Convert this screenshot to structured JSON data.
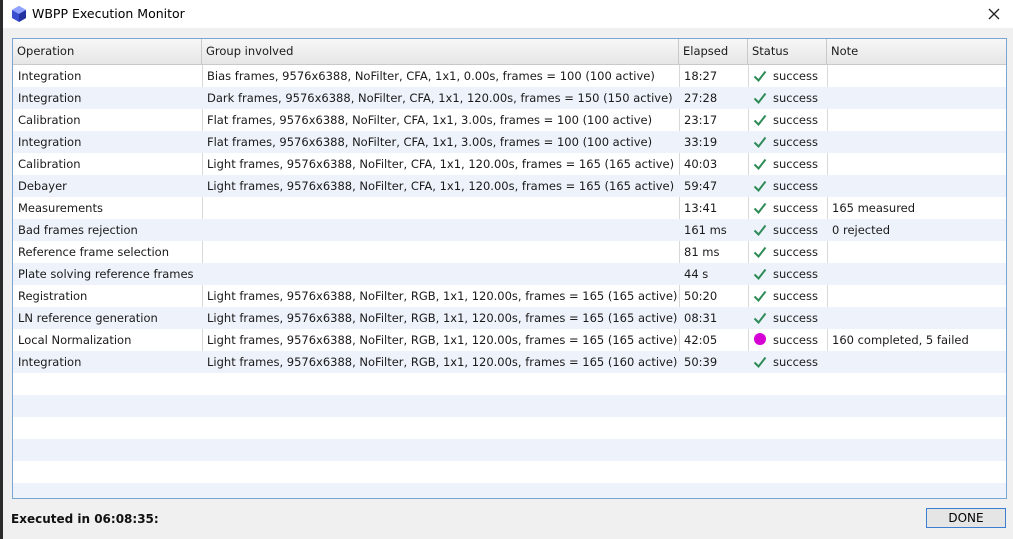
{
  "window": {
    "title": "WBPP Execution Monitor",
    "icons": {
      "app": "polyhedron-logo-icon",
      "close": "close-icon"
    },
    "colors": {
      "accent": "#3c7fd1",
      "check": "#2e8b57",
      "warning_dot": "#d400d4"
    }
  },
  "table": {
    "headers": {
      "operation": "Operation",
      "group": "Group involved",
      "elapsed": "Elapsed",
      "status": "Status",
      "note": "Note"
    },
    "rows": [
      {
        "operation": "Integration",
        "group": "Bias frames, 9576x6388, NoFilter, CFA, 1x1, 0.00s, frames = 100 (100 active)",
        "elapsed": "18:27",
        "status": "success",
        "status_icon": "check-icon",
        "note": ""
      },
      {
        "operation": "Integration",
        "group": "Dark frames, 9576x6388, NoFilter, CFA, 1x1, 120.00s, frames = 150 (150 active)",
        "elapsed": "27:28",
        "status": "success",
        "status_icon": "check-icon",
        "note": ""
      },
      {
        "operation": "Calibration",
        "group": "Flat frames, 9576x6388, NoFilter, CFA, 1x1, 3.00s, frames = 100 (100 active)",
        "elapsed": "23:17",
        "status": "success",
        "status_icon": "check-icon",
        "note": ""
      },
      {
        "operation": "Integration",
        "group": "Flat frames, 9576x6388, NoFilter, CFA, 1x1, 3.00s, frames = 100 (100 active)",
        "elapsed": "33:19",
        "status": "success",
        "status_icon": "check-icon",
        "note": ""
      },
      {
        "operation": "Calibration",
        "group": "Light frames, 9576x6388, NoFilter, CFA, 1x1, 120.00s, frames = 165 (165 active)",
        "elapsed": "40:03",
        "status": "success",
        "status_icon": "check-icon",
        "note": ""
      },
      {
        "operation": "Debayer",
        "group": "Light frames, 9576x6388, NoFilter, CFA, 1x1, 120.00s, frames = 165 (165 active)",
        "elapsed": "59:47",
        "status": "success",
        "status_icon": "check-icon",
        "note": ""
      },
      {
        "operation": "Measurements",
        "group": "",
        "elapsed": "13:41",
        "status": "success",
        "status_icon": "check-icon",
        "note": "165 measured"
      },
      {
        "operation": "Bad frames rejection",
        "group": "",
        "elapsed": "161 ms",
        "status": "success",
        "status_icon": "check-icon",
        "note": "0 rejected"
      },
      {
        "operation": "Reference frame selection",
        "group": "",
        "elapsed": "81 ms",
        "status": "success",
        "status_icon": "check-icon",
        "note": ""
      },
      {
        "operation": "Plate solving reference frames",
        "group": "",
        "elapsed": "44 s",
        "status": "success",
        "status_icon": "check-icon",
        "note": ""
      },
      {
        "operation": "Registration",
        "group": "Light frames, 9576x6388, NoFilter, RGB, 1x1, 120.00s, frames = 165 (165 active)",
        "elapsed": "50:20",
        "status": "success",
        "status_icon": "check-icon",
        "note": ""
      },
      {
        "operation": "LN reference generation",
        "group": "Light frames, 9576x6388, NoFilter, RGB, 1x1, 120.00s, frames = 165 (165 active)",
        "elapsed": "08:31",
        "status": "success",
        "status_icon": "check-icon",
        "note": ""
      },
      {
        "operation": "Local Normalization",
        "group": "Light frames, 9576x6388, NoFilter, RGB, 1x1, 120.00s, frames = 165 (165 active)",
        "elapsed": "42:05",
        "status": "success",
        "status_icon": "warning-dot-icon",
        "note": "160 completed, 5 failed"
      },
      {
        "operation": "Integration",
        "group": "Light frames, 9576x6388, NoFilter, RGB, 1x1, 120.00s, frames = 165 (160 active)",
        "elapsed": "50:39",
        "status": "success",
        "status_icon": "check-icon",
        "note": ""
      }
    ]
  },
  "footer": {
    "executed_label": "Executed in 06:08:35:",
    "done_label": "DONE"
  }
}
